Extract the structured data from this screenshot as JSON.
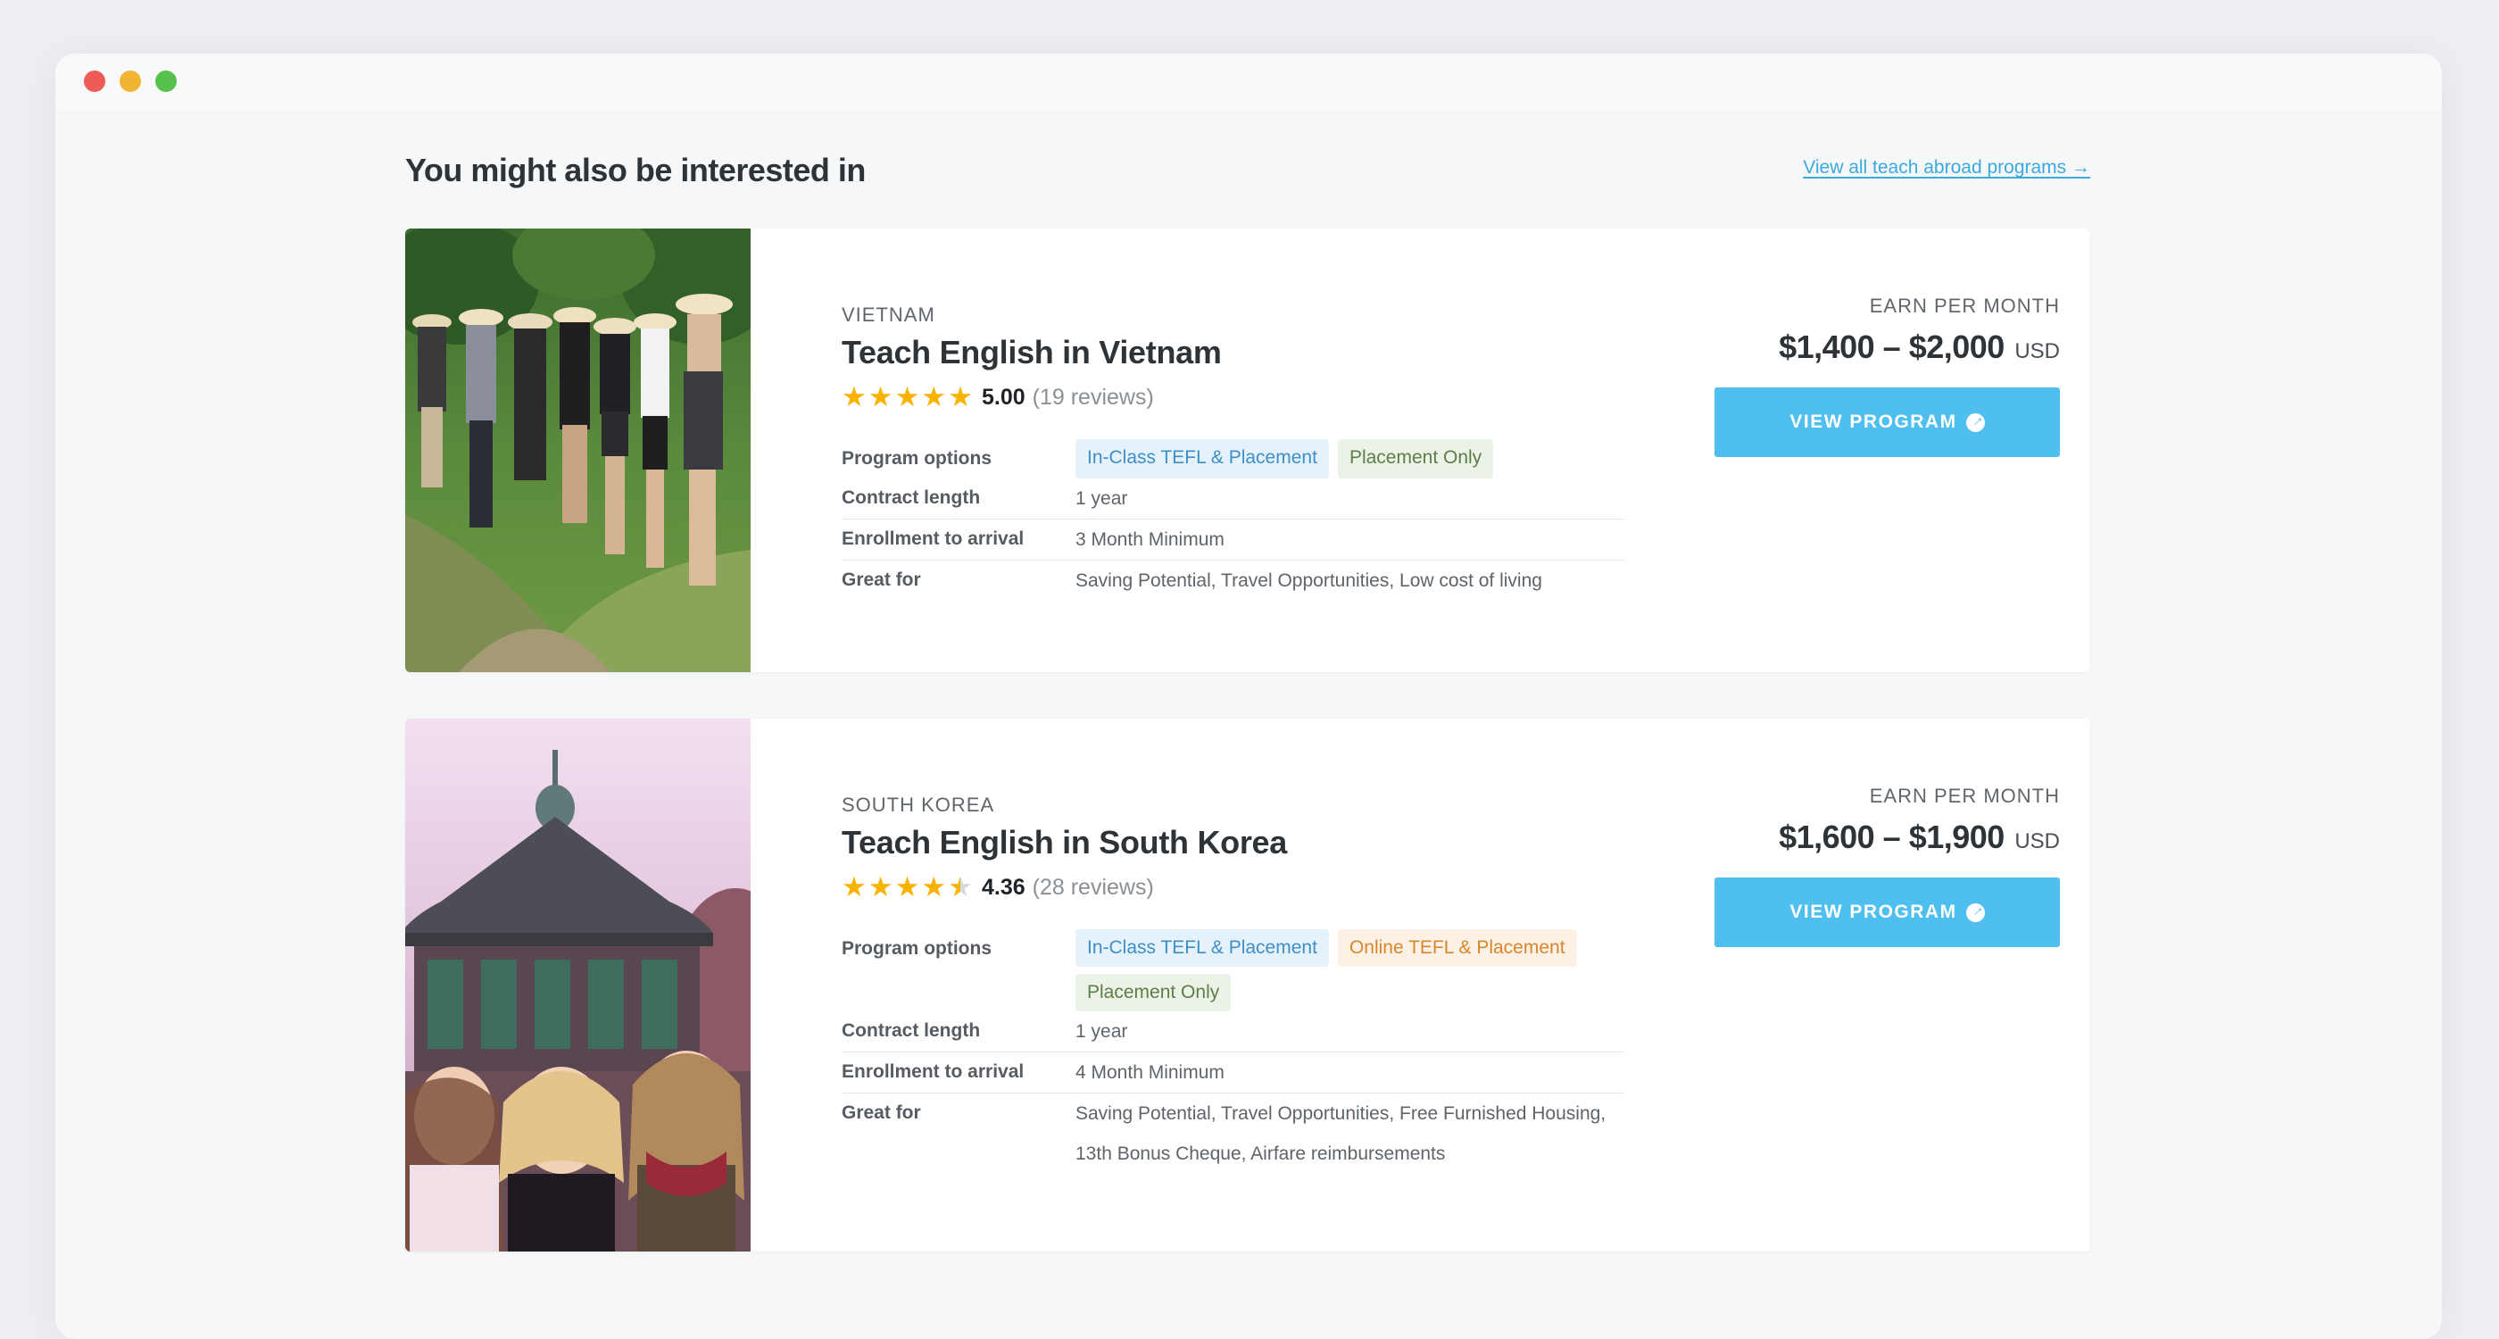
{
  "section": {
    "title": "You might also be interested in",
    "view_all": "View all teach abroad programs →"
  },
  "labels": {
    "earn": "EARN PER MONTH",
    "button": "VIEW PROGRAM",
    "program_options": "Program options",
    "contract_length": "Contract length",
    "enrollment": "Enrollment to arrival",
    "great_for": "Great for"
  },
  "programs": [
    {
      "country": "VIETNAM",
      "title": "Teach English in Vietnam",
      "rating": "5.00",
      "rating_value": 5.0,
      "reviews": "(19 reviews)",
      "options": [
        "In-Class TEFL & Placement",
        "Placement Only"
      ],
      "contract": "1 year",
      "enrollment": "3 Month Minimum",
      "great_for": "Saving Potential, Travel Opportunities, Low cost of living",
      "price": "$1,400 – $2,000",
      "currency": "USD"
    },
    {
      "country": "SOUTH KOREA",
      "title": "Teach English in South Korea",
      "rating": "4.36",
      "rating_value": 4.36,
      "reviews": "(28 reviews)",
      "options": [
        "In-Class TEFL & Placement",
        "Online TEFL & Placement",
        "Placement Only"
      ],
      "contract": "1 year",
      "enrollment": "4 Month Minimum",
      "great_for": "Saving Potential, Travel Opportunities, Free Furnished Housing, 13th Bonus Cheque, Airfare reimbursements",
      "price": "$1,600 – $1,900",
      "currency": "USD"
    }
  ],
  "colors": {
    "accent": "#4fbfef",
    "link": "#3aa9dc",
    "star": "#f7b300",
    "pill_blue": "#e5f2fb",
    "pill_green": "#ebf3e7",
    "pill_orange": "#fdf1e5"
  }
}
